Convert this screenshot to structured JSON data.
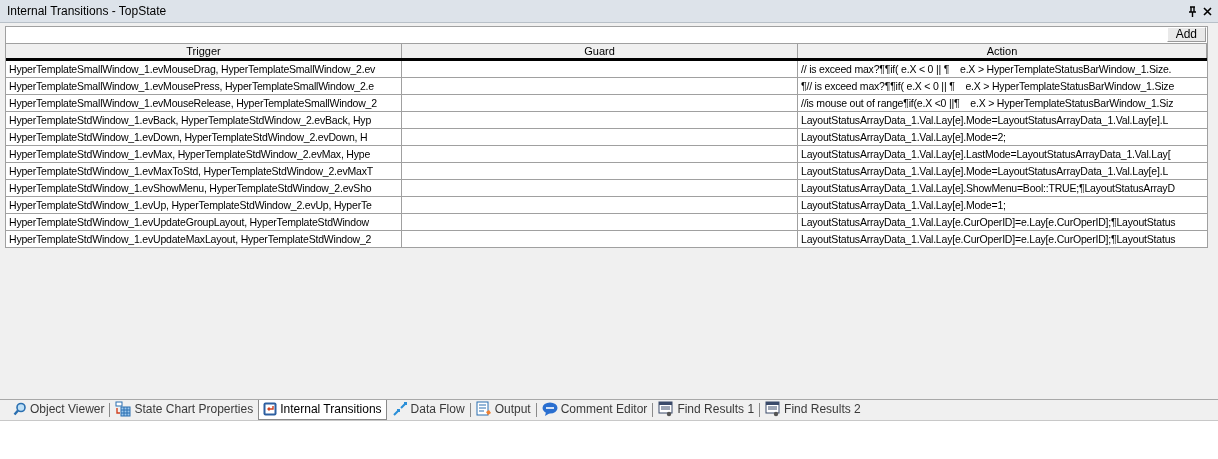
{
  "window": {
    "title": "Internal Transitions - TopState"
  },
  "toolbar": {
    "add_button": "Add"
  },
  "table": {
    "columns": [
      "Trigger",
      "Guard",
      "Action"
    ],
    "rows": [
      {
        "trigger": "HyperTemplateSmallWindow_1.evMouseDrag, HyperTemplateSmallWindow_2.ev",
        "guard": "",
        "action": "// is exceed max?¶¶if( e.X < 0 || ¶    e.X > HyperTemplateStatusBarWindow_1.Size."
      },
      {
        "trigger": "HyperTemplateSmallWindow_1.evMousePress, HyperTemplateSmallWindow_2.e",
        "guard": "",
        "action": "¶// is exceed max?¶¶if( e.X < 0 || ¶    e.X > HyperTemplateStatusBarWindow_1.Size"
      },
      {
        "trigger": "HyperTemplateSmallWindow_1.evMouseRelease, HyperTemplateSmallWindow_2",
        "guard": "",
        "action": "//is mouse out of range¶if(e.X <0 ||¶    e.X > HyperTemplateStatusBarWindow_1.Siz"
      },
      {
        "trigger": "HyperTemplateStdWindow_1.evBack, HyperTemplateStdWindow_2.evBack, Hyp",
        "guard": "",
        "action": "LayoutStatusArrayData_1.Val.Lay[e].Mode=LayoutStatusArrayData_1.Val.Lay[e].L"
      },
      {
        "trigger": "HyperTemplateStdWindow_1.evDown, HyperTemplateStdWindow_2.evDown, H",
        "guard": "",
        "action": "LayoutStatusArrayData_1.Val.Lay[e].Mode=2;"
      },
      {
        "trigger": "HyperTemplateStdWindow_1.evMax, HyperTemplateStdWindow_2.evMax, Hype",
        "guard": "",
        "action": "LayoutStatusArrayData_1.Val.Lay[e].LastMode=LayoutStatusArrayData_1.Val.Lay["
      },
      {
        "trigger": "HyperTemplateStdWindow_1.evMaxToStd, HyperTemplateStdWindow_2.evMaxT",
        "guard": "",
        "action": "LayoutStatusArrayData_1.Val.Lay[e].Mode=LayoutStatusArrayData_1.Val.Lay[e].L"
      },
      {
        "trigger": "HyperTemplateStdWindow_1.evShowMenu, HyperTemplateStdWindow_2.evSho",
        "guard": "",
        "action": "LayoutStatusArrayData_1.Val.Lay[e].ShowMenu=Bool::TRUE;¶LayoutStatusArrayD"
      },
      {
        "trigger": "HyperTemplateStdWindow_1.evUp, HyperTemplateStdWindow_2.evUp, HyperTe",
        "guard": "",
        "action": "LayoutStatusArrayData_1.Val.Lay[e].Mode=1;"
      },
      {
        "trigger": "HyperTemplateStdWindow_1.evUpdateGroupLayout, HyperTemplateStdWindow",
        "guard": "",
        "action": "LayoutStatusArrayData_1.Val.Lay[e.CurOperID]=e.Lay[e.CurOperID];¶LayoutStatus"
      },
      {
        "trigger": "HyperTemplateStdWindow_1.evUpdateMaxLayout, HyperTemplateStdWindow_2",
        "guard": "",
        "action": "LayoutStatusArrayData_1.Val.Lay[e.CurOperID]=e.Lay[e.CurOperID];¶LayoutStatus"
      }
    ]
  },
  "tabs": [
    {
      "label": "Object Viewer",
      "selected": false
    },
    {
      "label": "State Chart Properties",
      "selected": false
    },
    {
      "label": "Internal Transitions",
      "selected": true
    },
    {
      "label": "Data Flow",
      "selected": false
    },
    {
      "label": "Output",
      "selected": false
    },
    {
      "label": "Comment Editor",
      "selected": false
    },
    {
      "label": "Find Results 1",
      "selected": false
    },
    {
      "label": "Find Results 2",
      "selected": false
    }
  ]
}
